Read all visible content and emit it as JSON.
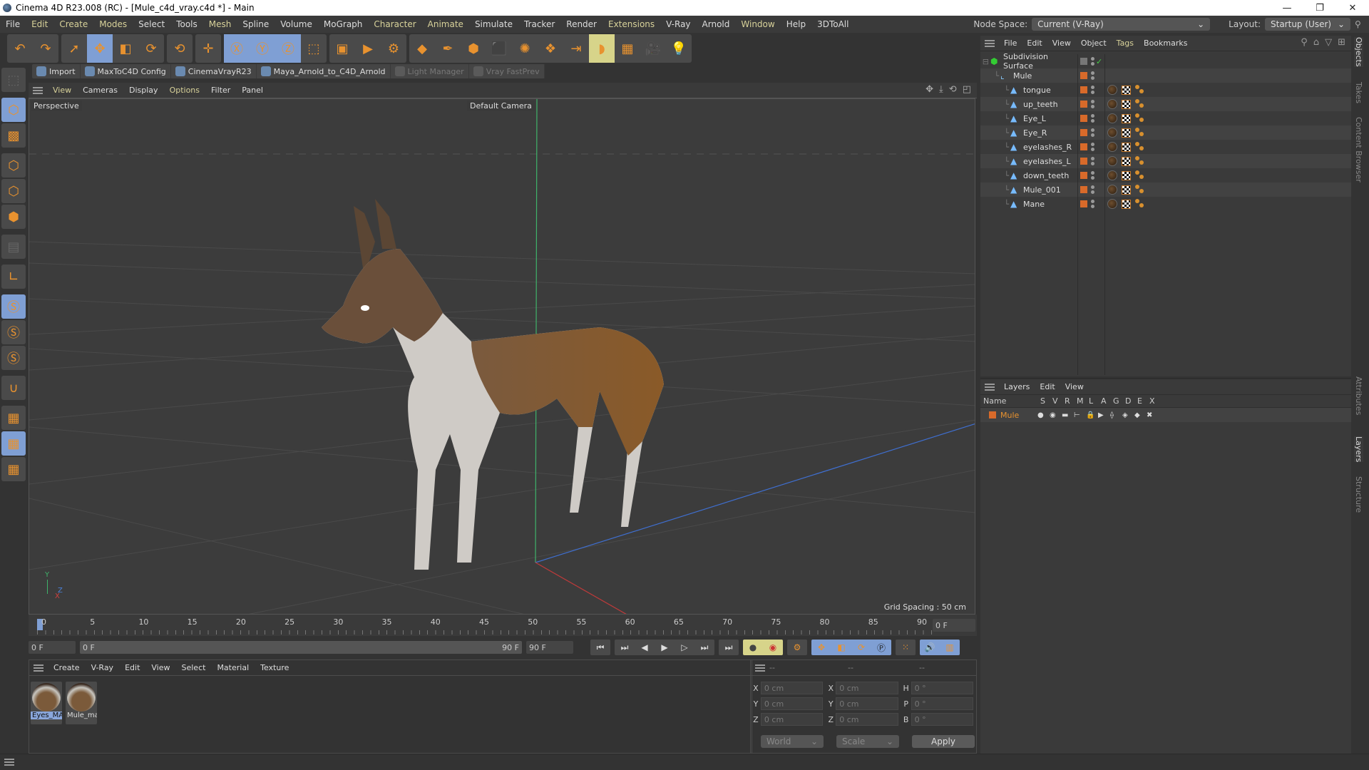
{
  "window": {
    "title": "Cinema 4D R23.008 (RC) - [Mule_c4d_vray.c4d *] - Main",
    "controls": [
      "minimize",
      "restore",
      "close"
    ]
  },
  "menubar": {
    "items": [
      {
        "label": "File",
        "hl": false
      },
      {
        "label": "Edit",
        "hl": true
      },
      {
        "label": "Create",
        "hl": true
      },
      {
        "label": "Modes",
        "hl": true
      },
      {
        "label": "Select",
        "hl": false
      },
      {
        "label": "Tools",
        "hl": false
      },
      {
        "label": "Mesh",
        "hl": true
      },
      {
        "label": "Spline",
        "hl": false
      },
      {
        "label": "Volume",
        "hl": false
      },
      {
        "label": "MoGraph",
        "hl": false
      },
      {
        "label": "Character",
        "hl": true
      },
      {
        "label": "Animate",
        "hl": true
      },
      {
        "label": "Simulate",
        "hl": false
      },
      {
        "label": "Tracker",
        "hl": false
      },
      {
        "label": "Render",
        "hl": false
      },
      {
        "label": "Extensions",
        "hl": true
      },
      {
        "label": "V-Ray",
        "hl": false
      },
      {
        "label": "Arnold",
        "hl": false
      },
      {
        "label": "Window",
        "hl": true
      },
      {
        "label": "Help",
        "hl": false
      },
      {
        "label": "3DToAll",
        "hl": false
      }
    ],
    "node_space_label": "Node Space:",
    "node_space_value": "Current (V-Ray)",
    "layout_label": "Layout:",
    "layout_value": "Startup (User)"
  },
  "toolbar": {
    "groups": [
      [
        {
          "icon": "undo-icon",
          "glyph": "↶"
        },
        {
          "icon": "redo-icon",
          "glyph": "↷"
        }
      ],
      [
        {
          "icon": "select-icon",
          "glyph": "➚"
        },
        {
          "icon": "move-icon",
          "glyph": "✥",
          "sel": true
        },
        {
          "icon": "scale-icon",
          "glyph": "◧"
        },
        {
          "icon": "rotate-icon",
          "glyph": "⟳"
        }
      ],
      [
        {
          "icon": "psr-icon",
          "glyph": "⟲"
        }
      ],
      [
        {
          "icon": "add-icon",
          "glyph": "✛"
        }
      ],
      [
        {
          "icon": "x-axis-icon",
          "glyph": "Ⓧ",
          "sel": true
        },
        {
          "icon": "y-axis-icon",
          "glyph": "Ⓨ",
          "sel": true
        },
        {
          "icon": "z-axis-icon",
          "glyph": "Ⓩ",
          "sel": true
        },
        {
          "icon": "coordinate-system-icon",
          "glyph": "⬚"
        }
      ],
      [
        {
          "icon": "render-view-icon",
          "glyph": "▣"
        },
        {
          "icon": "render-picture-viewer-icon",
          "glyph": "▶"
        },
        {
          "icon": "render-settings-icon",
          "glyph": "⚙"
        }
      ],
      [
        {
          "icon": "cube-icon",
          "glyph": "◆"
        },
        {
          "icon": "pen-icon",
          "glyph": "✒"
        },
        {
          "icon": "subdivision-icon",
          "glyph": "⬢"
        },
        {
          "icon": "extrude-icon",
          "glyph": "⬛"
        },
        {
          "icon": "mograph-cloner-icon",
          "glyph": "✺"
        },
        {
          "icon": "array-icon",
          "glyph": "❖"
        },
        {
          "icon": "deformer-icon",
          "glyph": "⇥"
        },
        {
          "icon": "bend-icon",
          "glyph": "◗",
          "yel": true
        },
        {
          "icon": "floor-icon",
          "glyph": "▦"
        },
        {
          "icon": "camera-icon",
          "glyph": "🎥"
        },
        {
          "icon": "light-icon",
          "glyph": "💡"
        }
      ]
    ]
  },
  "plugin_bar": [
    {
      "label": "Import",
      "icon": "import-icon",
      "dim": false
    },
    {
      "label": "MaxToC4D Config",
      "icon": "wrench-icon",
      "dim": false
    },
    {
      "label": "CinemaVrayR23",
      "icon": "python-icon",
      "dim": false
    },
    {
      "label": "Maya_Arnold_to_C4D_Arnold",
      "icon": "python-icon",
      "dim": false
    },
    {
      "label": "Light Manager",
      "icon": "shield-icon",
      "dim": true
    },
    {
      "label": "Vray FastPrev",
      "icon": "shield-icon",
      "dim": true
    }
  ],
  "left_toolbar": [
    {
      "icon": "make-editable-icon",
      "glyph": "⬚",
      "dim": true
    },
    {
      "icon": "model-mode-icon",
      "glyph": "⬡",
      "sel": true,
      "gap": true
    },
    {
      "icon": "texture-mode-icon",
      "glyph": "▩"
    },
    {
      "icon": "points-mode-icon",
      "glyph": "⬡",
      "gap": true
    },
    {
      "icon": "edges-mode-icon",
      "glyph": "⬡"
    },
    {
      "icon": "polygons-mode-icon",
      "glyph": "⬢"
    },
    {
      "icon": "uv-mode-icon",
      "glyph": "▤",
      "dim": true,
      "gap": true
    },
    {
      "icon": "axis-icon",
      "glyph": "∟",
      "gap": true
    },
    {
      "icon": "snap-s-icon",
      "glyph": "Ⓢ",
      "sel": true,
      "gap": true
    },
    {
      "icon": "snap-s2-icon",
      "glyph": "Ⓢ"
    },
    {
      "icon": "snap-s3-icon",
      "glyph": "Ⓢ"
    },
    {
      "icon": "magnet-icon",
      "glyph": "∪",
      "gap": true
    },
    {
      "icon": "workplane-icon",
      "glyph": "▦",
      "gap": true
    },
    {
      "icon": "locked-workplane-icon",
      "glyph": "▦",
      "sel": true
    },
    {
      "icon": "workplane-sync-icon",
      "glyph": "▦"
    }
  ],
  "viewport": {
    "menu": [
      {
        "label": "View",
        "hl": true
      },
      {
        "label": "Cameras",
        "hl": false
      },
      {
        "label": "Display",
        "hl": false
      },
      {
        "label": "Options",
        "hl": true
      },
      {
        "label": "Filter",
        "hl": false
      },
      {
        "label": "Panel",
        "hl": false
      }
    ],
    "view_name": "Perspective",
    "camera": "Default Camera",
    "grid_spacing": "Grid Spacing : 50 cm",
    "axis_labels": {
      "x": "X",
      "y": "Y",
      "z": "Z"
    }
  },
  "timeline": {
    "ticks": [
      "0",
      "5",
      "10",
      "15",
      "20",
      "25",
      "30",
      "35",
      "40",
      "45",
      "50",
      "55",
      "60",
      "65",
      "70",
      "75",
      "80",
      "85",
      "90"
    ],
    "current_frame": "0 F",
    "start_frame": "0 F",
    "range_start": "0 F",
    "range_end": "90 F",
    "end_frame": "90 F"
  },
  "material_manager": {
    "menu": [
      "Create",
      "V-Ray",
      "Edit",
      "View",
      "Select",
      "Material",
      "Texture"
    ],
    "materials": [
      {
        "name": "Eyes_MA",
        "selected": true
      },
      {
        "name": "Mule_ma",
        "selected": false
      }
    ]
  },
  "coordinates": {
    "headers": [
      "--",
      "--",
      "--"
    ],
    "rows": [
      {
        "l1": "X",
        "v1": "0 cm",
        "l2": "X",
        "v2": "0 cm",
        "l3": "H",
        "v3": "0 °"
      },
      {
        "l1": "Y",
        "v1": "0 cm",
        "l2": "Y",
        "v2": "0 cm",
        "l3": "P",
        "v3": "0 °"
      },
      {
        "l1": "Z",
        "v1": "0 cm",
        "l2": "Z",
        "v2": "0 cm",
        "l3": "B",
        "v3": "0 °"
      }
    ],
    "space": "World",
    "mode": "Scale",
    "apply_label": "Apply"
  },
  "object_manager": {
    "menu": [
      {
        "label": "File",
        "hl": false
      },
      {
        "label": "Edit",
        "hl": false
      },
      {
        "label": "View",
        "hl": false
      },
      {
        "label": "Object",
        "hl": false
      },
      {
        "label": "Tags",
        "hl": true
      },
      {
        "label": "Bookmarks",
        "hl": false
      }
    ],
    "root": "Subdivision Surface",
    "group": "Mule",
    "objects": [
      "tongue",
      "up_teeth",
      "Eye_L",
      "Eye_R",
      "eyelashes_R",
      "eyelashes_L",
      "down_teeth",
      "Mule_001",
      "Mane"
    ]
  },
  "layer_manager": {
    "menu": [
      "Layers",
      "Edit",
      "View"
    ],
    "columns": [
      "Name",
      "S",
      "V",
      "R",
      "M",
      "L",
      "A",
      "G",
      "D",
      "E",
      "X"
    ],
    "layers": [
      {
        "name": "Mule",
        "color": "#d86a2a"
      }
    ]
  },
  "side_tabs": {
    "top": [
      {
        "label": "Objects",
        "active": true
      },
      {
        "label": "Takes",
        "active": false
      },
      {
        "label": "Content Browser",
        "active": false
      }
    ],
    "bottom": [
      {
        "label": "Attributes",
        "active": false
      },
      {
        "label": "Layers",
        "active": true
      },
      {
        "label": "Structure",
        "active": false
      }
    ]
  }
}
